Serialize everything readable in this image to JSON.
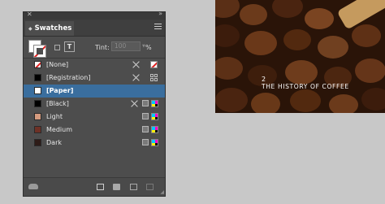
{
  "panel": {
    "tab_label": "Swatches",
    "tint_label": "Tint:",
    "tint_value": "100",
    "tint_unit": "%"
  },
  "swatches": [
    {
      "name": "[None]",
      "color": "none"
    },
    {
      "name": "[Registration]",
      "color": "#000000"
    },
    {
      "name": "[Paper]",
      "color": "#ffffff",
      "selected": true
    },
    {
      "name": "[Black]",
      "color": "#000000"
    },
    {
      "name": "Light",
      "color": "#d49a7e"
    },
    {
      "name": "Medium",
      "color": "#6e3126"
    },
    {
      "name": "Dark",
      "color": "#2e1c18"
    }
  ],
  "colors": {
    "panel_bg": "#4d4d4d",
    "selected_row": "#3a6e9e",
    "canvas_bg": "#c8c8c8"
  },
  "photo": {
    "number": "2",
    "title": "THE HISTORY OF COFFEE"
  }
}
